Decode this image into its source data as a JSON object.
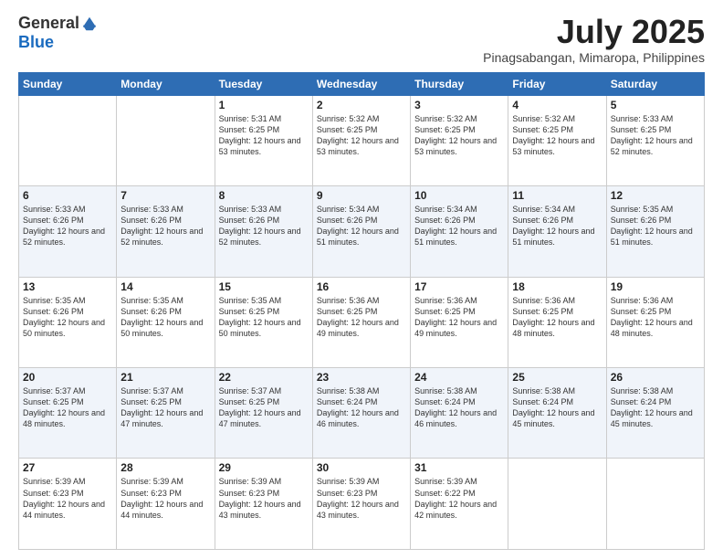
{
  "logo": {
    "general": "General",
    "blue": "Blue"
  },
  "header": {
    "month": "July 2025",
    "location": "Pinagsabangan, Mimaropa, Philippines"
  },
  "days": [
    "Sunday",
    "Monday",
    "Tuesday",
    "Wednesday",
    "Thursday",
    "Friday",
    "Saturday"
  ],
  "weeks": [
    [
      {
        "day": "",
        "sunrise": "",
        "sunset": "",
        "daylight": ""
      },
      {
        "day": "",
        "sunrise": "",
        "sunset": "",
        "daylight": ""
      },
      {
        "day": "1",
        "sunrise": "Sunrise: 5:31 AM",
        "sunset": "Sunset: 6:25 PM",
        "daylight": "Daylight: 12 hours and 53 minutes."
      },
      {
        "day": "2",
        "sunrise": "Sunrise: 5:32 AM",
        "sunset": "Sunset: 6:25 PM",
        "daylight": "Daylight: 12 hours and 53 minutes."
      },
      {
        "day": "3",
        "sunrise": "Sunrise: 5:32 AM",
        "sunset": "Sunset: 6:25 PM",
        "daylight": "Daylight: 12 hours and 53 minutes."
      },
      {
        "day": "4",
        "sunrise": "Sunrise: 5:32 AM",
        "sunset": "Sunset: 6:25 PM",
        "daylight": "Daylight: 12 hours and 53 minutes."
      },
      {
        "day": "5",
        "sunrise": "Sunrise: 5:33 AM",
        "sunset": "Sunset: 6:25 PM",
        "daylight": "Daylight: 12 hours and 52 minutes."
      }
    ],
    [
      {
        "day": "6",
        "sunrise": "Sunrise: 5:33 AM",
        "sunset": "Sunset: 6:26 PM",
        "daylight": "Daylight: 12 hours and 52 minutes."
      },
      {
        "day": "7",
        "sunrise": "Sunrise: 5:33 AM",
        "sunset": "Sunset: 6:26 PM",
        "daylight": "Daylight: 12 hours and 52 minutes."
      },
      {
        "day": "8",
        "sunrise": "Sunrise: 5:33 AM",
        "sunset": "Sunset: 6:26 PM",
        "daylight": "Daylight: 12 hours and 52 minutes."
      },
      {
        "day": "9",
        "sunrise": "Sunrise: 5:34 AM",
        "sunset": "Sunset: 6:26 PM",
        "daylight": "Daylight: 12 hours and 51 minutes."
      },
      {
        "day": "10",
        "sunrise": "Sunrise: 5:34 AM",
        "sunset": "Sunset: 6:26 PM",
        "daylight": "Daylight: 12 hours and 51 minutes."
      },
      {
        "day": "11",
        "sunrise": "Sunrise: 5:34 AM",
        "sunset": "Sunset: 6:26 PM",
        "daylight": "Daylight: 12 hours and 51 minutes."
      },
      {
        "day": "12",
        "sunrise": "Sunrise: 5:35 AM",
        "sunset": "Sunset: 6:26 PM",
        "daylight": "Daylight: 12 hours and 51 minutes."
      }
    ],
    [
      {
        "day": "13",
        "sunrise": "Sunrise: 5:35 AM",
        "sunset": "Sunset: 6:26 PM",
        "daylight": "Daylight: 12 hours and 50 minutes."
      },
      {
        "day": "14",
        "sunrise": "Sunrise: 5:35 AM",
        "sunset": "Sunset: 6:26 PM",
        "daylight": "Daylight: 12 hours and 50 minutes."
      },
      {
        "day": "15",
        "sunrise": "Sunrise: 5:35 AM",
        "sunset": "Sunset: 6:25 PM",
        "daylight": "Daylight: 12 hours and 50 minutes."
      },
      {
        "day": "16",
        "sunrise": "Sunrise: 5:36 AM",
        "sunset": "Sunset: 6:25 PM",
        "daylight": "Daylight: 12 hours and 49 minutes."
      },
      {
        "day": "17",
        "sunrise": "Sunrise: 5:36 AM",
        "sunset": "Sunset: 6:25 PM",
        "daylight": "Daylight: 12 hours and 49 minutes."
      },
      {
        "day": "18",
        "sunrise": "Sunrise: 5:36 AM",
        "sunset": "Sunset: 6:25 PM",
        "daylight": "Daylight: 12 hours and 48 minutes."
      },
      {
        "day": "19",
        "sunrise": "Sunrise: 5:36 AM",
        "sunset": "Sunset: 6:25 PM",
        "daylight": "Daylight: 12 hours and 48 minutes."
      }
    ],
    [
      {
        "day": "20",
        "sunrise": "Sunrise: 5:37 AM",
        "sunset": "Sunset: 6:25 PM",
        "daylight": "Daylight: 12 hours and 48 minutes."
      },
      {
        "day": "21",
        "sunrise": "Sunrise: 5:37 AM",
        "sunset": "Sunset: 6:25 PM",
        "daylight": "Daylight: 12 hours and 47 minutes."
      },
      {
        "day": "22",
        "sunrise": "Sunrise: 5:37 AM",
        "sunset": "Sunset: 6:25 PM",
        "daylight": "Daylight: 12 hours and 47 minutes."
      },
      {
        "day": "23",
        "sunrise": "Sunrise: 5:38 AM",
        "sunset": "Sunset: 6:24 PM",
        "daylight": "Daylight: 12 hours and 46 minutes."
      },
      {
        "day": "24",
        "sunrise": "Sunrise: 5:38 AM",
        "sunset": "Sunset: 6:24 PM",
        "daylight": "Daylight: 12 hours and 46 minutes."
      },
      {
        "day": "25",
        "sunrise": "Sunrise: 5:38 AM",
        "sunset": "Sunset: 6:24 PM",
        "daylight": "Daylight: 12 hours and 45 minutes."
      },
      {
        "day": "26",
        "sunrise": "Sunrise: 5:38 AM",
        "sunset": "Sunset: 6:24 PM",
        "daylight": "Daylight: 12 hours and 45 minutes."
      }
    ],
    [
      {
        "day": "27",
        "sunrise": "Sunrise: 5:39 AM",
        "sunset": "Sunset: 6:23 PM",
        "daylight": "Daylight: 12 hours and 44 minutes."
      },
      {
        "day": "28",
        "sunrise": "Sunrise: 5:39 AM",
        "sunset": "Sunset: 6:23 PM",
        "daylight": "Daylight: 12 hours and 44 minutes."
      },
      {
        "day": "29",
        "sunrise": "Sunrise: 5:39 AM",
        "sunset": "Sunset: 6:23 PM",
        "daylight": "Daylight: 12 hours and 43 minutes."
      },
      {
        "day": "30",
        "sunrise": "Sunrise: 5:39 AM",
        "sunset": "Sunset: 6:23 PM",
        "daylight": "Daylight: 12 hours and 43 minutes."
      },
      {
        "day": "31",
        "sunrise": "Sunrise: 5:39 AM",
        "sunset": "Sunset: 6:22 PM",
        "daylight": "Daylight: 12 hours and 42 minutes."
      },
      {
        "day": "",
        "sunrise": "",
        "sunset": "",
        "daylight": ""
      },
      {
        "day": "",
        "sunrise": "",
        "sunset": "",
        "daylight": ""
      }
    ]
  ]
}
